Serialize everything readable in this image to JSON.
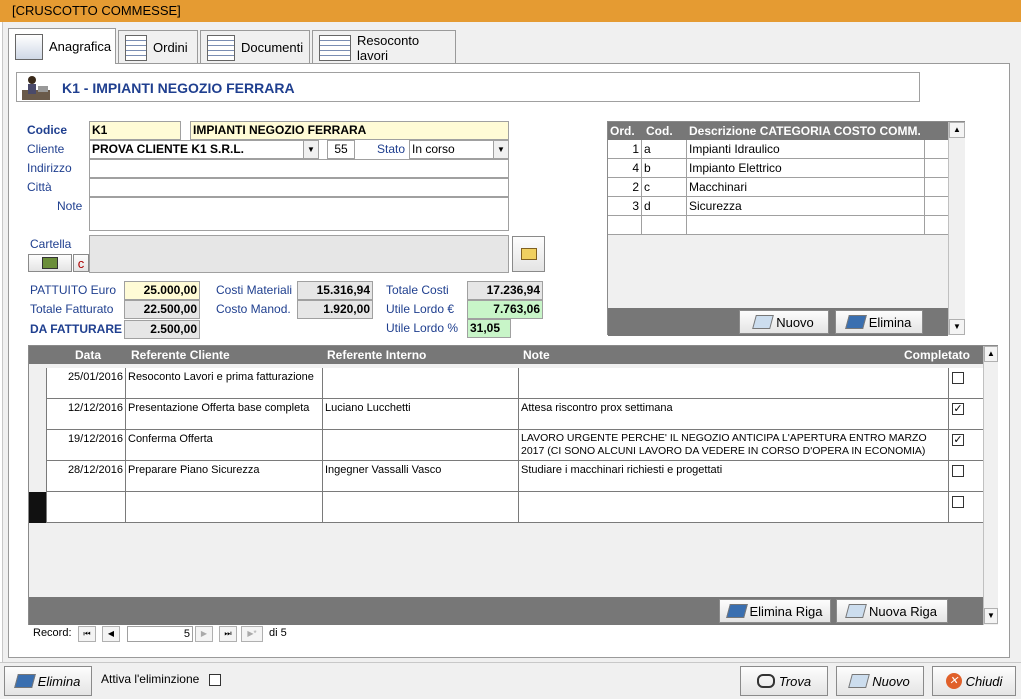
{
  "window": {
    "title": "[CRUSCOTTO COMMESSE]"
  },
  "tabs": [
    {
      "label": "Anagrafica"
    },
    {
      "label": "Ordini"
    },
    {
      "label": "Documenti"
    },
    {
      "label": "Resoconto lavori"
    }
  ],
  "header": {
    "title": "K1 - IMPIANTI NEGOZIO FERRARA"
  },
  "form": {
    "codice_label": "Codice",
    "codice": "K1",
    "descrizione": "IMPIANTI NEGOZIO FERRARA",
    "cliente_label": "Cliente",
    "cliente": "PROVA CLIENTE K1 S.R.L.",
    "cliente_num": "55",
    "stato_label": "Stato",
    "stato": "In corso",
    "indirizzo_label": "Indirizzo",
    "citta_label": "Città",
    "note_label": "Note",
    "cartella_label": "Cartella",
    "c_label": "c"
  },
  "totals": {
    "pattuito_label": "PATTUITO Euro",
    "pattuito": "25.000,00",
    "fatturato_label": "Totale Fatturato",
    "fatturato": "22.500,00",
    "dafatturare_label": "DA FATTURARE",
    "dafatturare": "2.500,00",
    "costi_mat_label": "Costi Materiali",
    "costi_mat": "15.316,94",
    "costo_man_label": "Costo Manod.",
    "costo_man": "1.920,00",
    "totale_costi_label": "Totale Costi",
    "totale_costi": "17.236,94",
    "utile_label": "Utile Lordo €",
    "utile": "7.763,06",
    "utile_pct_label": "Utile Lordo %",
    "utile_pct": "31,05"
  },
  "categories": {
    "headers": [
      "Ord.",
      "Cod.",
      "Descrizione CATEGORIA COSTO COMM."
    ],
    "rows": [
      [
        "1",
        "a",
        "Impianti Idraulico"
      ],
      [
        "4",
        "b",
        "Impianto Elettrico"
      ],
      [
        "2",
        "c",
        "Macchinari"
      ],
      [
        "3",
        "d",
        "Sicurezza"
      ]
    ],
    "nuovo": "Nuovo",
    "elimina": "Elimina"
  },
  "log": {
    "headers": [
      "Data",
      "Referente Cliente",
      "Referente Interno",
      "Note",
      "Completato"
    ],
    "rows": [
      {
        "data": "25/01/2016",
        "cliente": "Resoconto Lavori e prima fatturazione",
        "interno": "",
        "note": "",
        "done": "false"
      },
      {
        "data": "12/12/2016",
        "cliente": "Presentazione Offerta base completa",
        "interno": "Luciano Lucchetti",
        "note": "Attesa riscontro prox settimana",
        "done": "true"
      },
      {
        "data": "19/12/2016",
        "cliente": "Conferma Offerta",
        "interno": "",
        "note": "LAVORO URGENTE PERCHE' IL NEGOZIO ANTICIPA L'APERTURA ENTRO MARZO 2017 (CI SONO ALCUNI LAVORO DA VEDERE IN CORSO D'OPERA IN ECONOMIA)",
        "done": "true"
      },
      {
        "data": "28/12/2016",
        "cliente": "Preparare Piano Sicurezza",
        "interno": "Ingegner Vassalli Vasco",
        "note": "Studiare i macchinari richiesti e progettati",
        "done": "false"
      }
    ],
    "elimina_riga": "Elimina Riga",
    "nuova_riga": "Nuova Riga"
  },
  "record_nav": {
    "label": "Record:",
    "current": "5",
    "of": "di 5"
  },
  "bottom": {
    "elimina": "Elimina",
    "attiva": "Attiva l'eliminzione",
    "trova": "Trova",
    "nuovo": "Nuovo",
    "chiudi": "Chiudi"
  }
}
